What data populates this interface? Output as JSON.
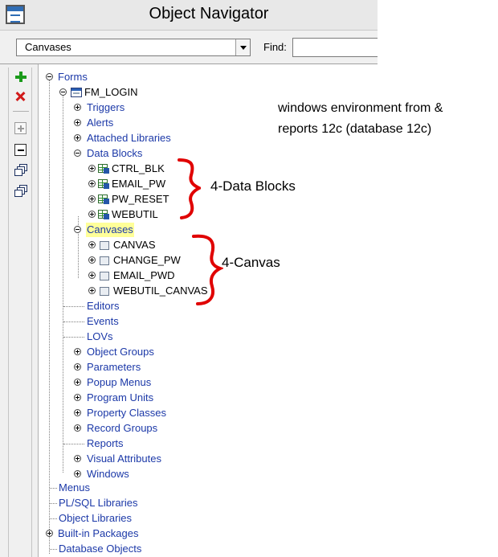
{
  "window": {
    "title": "Object Navigator",
    "icon": "object-navigator-icon"
  },
  "toolbar": {
    "context_value": "Canvases",
    "find_label": "Find:",
    "find_value": ""
  },
  "side_toolbar": [
    {
      "name": "create-button",
      "icon": "plus-green-icon"
    },
    {
      "name": "delete-button",
      "icon": "x-red-icon"
    },
    {
      "name": "expand-button",
      "icon": "expand-box-icon"
    },
    {
      "name": "collapse-button",
      "icon": "collapse-box-icon"
    },
    {
      "name": "expand-all-button",
      "icon": "stack-expand-icon"
    },
    {
      "name": "collapse-all-button",
      "icon": "stack-collapse-icon"
    }
  ],
  "tree": {
    "forms": "Forms",
    "module": "FM_LOGIN",
    "triggers": "Triggers",
    "alerts": "Alerts",
    "attached_libraries": "Attached Libraries",
    "data_blocks": "Data Blocks",
    "blocks": [
      "CTRL_BLK",
      "EMAIL_PW",
      "PW_RESET",
      "WEBUTIL"
    ],
    "canvases": "Canvases",
    "canvas_items": [
      "CANVAS",
      "CHANGE_PW",
      "EMAIL_PWD",
      "WEBUTIL_CANVAS"
    ],
    "editors": "Editors",
    "events": "Events",
    "lovs": "LOVs",
    "object_groups": "Object Groups",
    "parameters": "Parameters",
    "popup_menus": "Popup Menus",
    "program_units": "Program Units",
    "property_classes": "Property Classes",
    "record_groups": "Record Groups",
    "reports": "Reports",
    "visual_attributes": "Visual Attributes",
    "windows": "Windows",
    "menus": "Menus",
    "plsql_libraries": "PL/SQL Libraries",
    "object_libraries": "Object Libraries",
    "builtin_packages": "Built-in Packages",
    "database_objects": "Database Objects"
  },
  "annotations": {
    "environment_line1": "windows environment from &",
    "environment_line2": "reports 12c  (database 12c)",
    "blocks_note": "4-Data Blocks",
    "canvas_note": "4-Canvas",
    "bracket_color": "#e00000"
  },
  "colors": {
    "tree_link": "#1c39a8",
    "highlight": "#ffff99"
  }
}
